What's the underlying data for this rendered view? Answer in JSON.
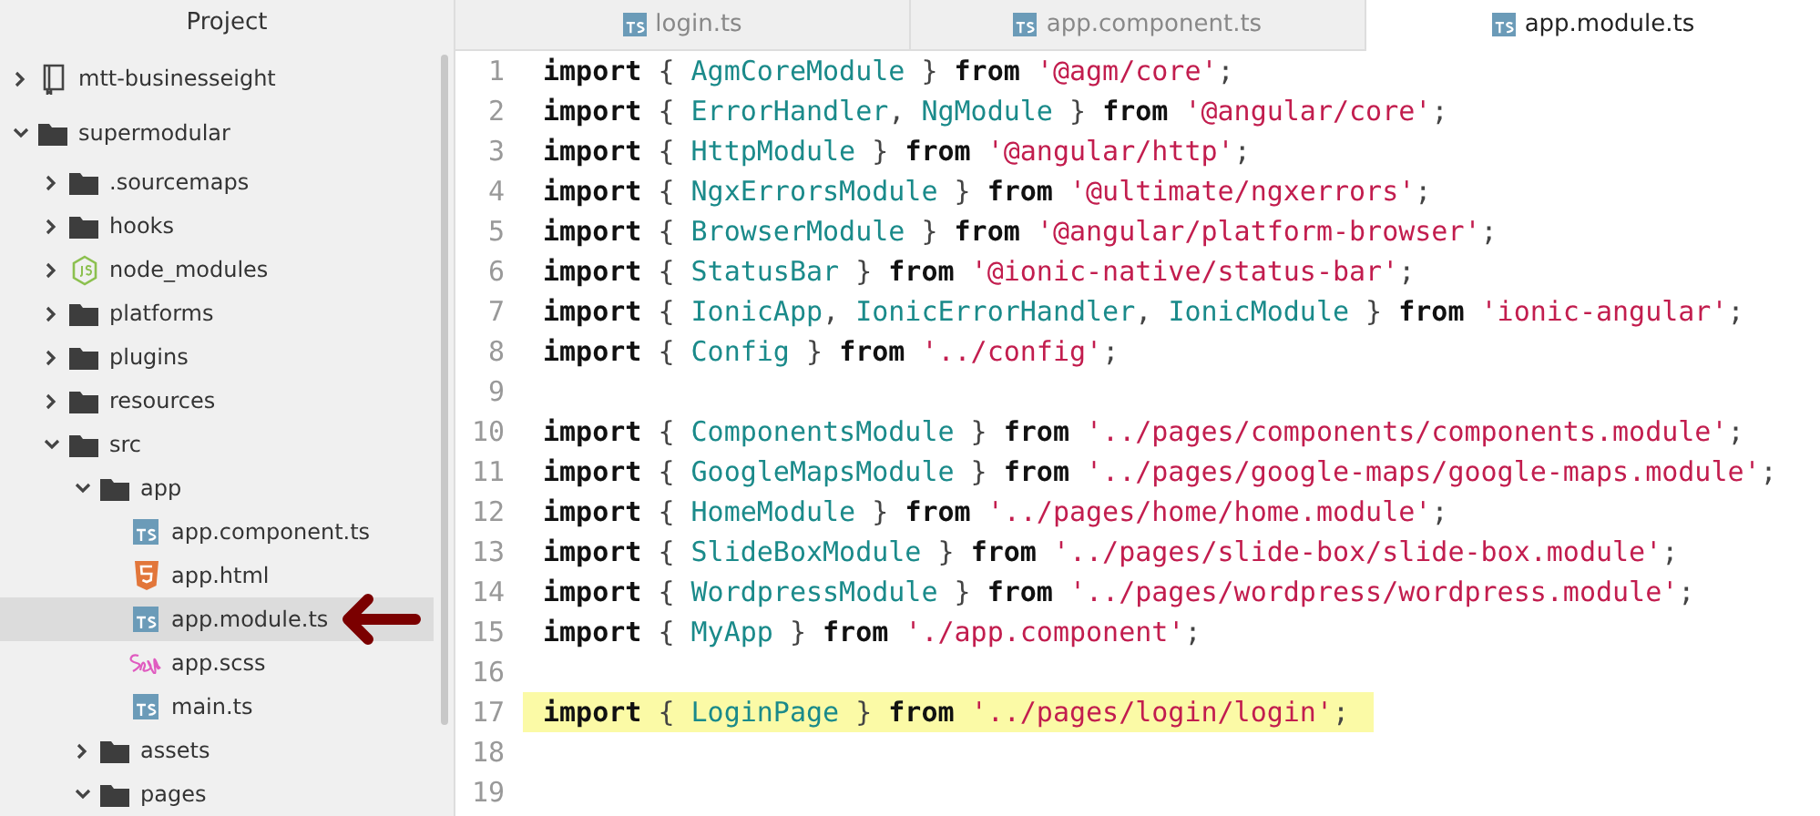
{
  "sidebar": {
    "title": "Project",
    "tree": [
      {
        "label": "mtt-businesseight",
        "kind": "book",
        "expanded": false,
        "selected": false
      },
      {
        "label": "supermodular",
        "kind": "folder",
        "expanded": true,
        "selected": false,
        "children": [
          {
            "label": ".sourcemaps",
            "kind": "folder",
            "expanded": false,
            "selected": false
          },
          {
            "label": "hooks",
            "kind": "folder",
            "expanded": false,
            "selected": false
          },
          {
            "label": "node_modules",
            "kind": "nodejs",
            "expanded": false,
            "selected": false
          },
          {
            "label": "platforms",
            "kind": "folder",
            "expanded": false,
            "selected": false
          },
          {
            "label": "plugins",
            "kind": "folder",
            "expanded": false,
            "selected": false
          },
          {
            "label": "resources",
            "kind": "folder",
            "expanded": false,
            "selected": false
          },
          {
            "label": "src",
            "kind": "folder",
            "expanded": true,
            "selected": false,
            "children": [
              {
                "label": "app",
                "kind": "folder",
                "expanded": true,
                "selected": false,
                "children": [
                  {
                    "label": "app.component.ts",
                    "kind": "ts",
                    "selected": false
                  },
                  {
                    "label": "app.html",
                    "kind": "html",
                    "selected": false
                  },
                  {
                    "label": "app.module.ts",
                    "kind": "ts",
                    "selected": true
                  },
                  {
                    "label": "app.scss",
                    "kind": "sass",
                    "selected": false
                  },
                  {
                    "label": "main.ts",
                    "kind": "ts",
                    "selected": false
                  }
                ]
              },
              {
                "label": "assets",
                "kind": "folder",
                "expanded": false,
                "selected": false
              },
              {
                "label": "pages",
                "kind": "folder",
                "expanded": true,
                "selected": false
              }
            ]
          }
        ]
      }
    ]
  },
  "tabs": [
    {
      "label": "login.ts",
      "selected": false
    },
    {
      "label": "app.component.ts",
      "selected": false
    },
    {
      "label": "app.module.ts",
      "selected": true
    }
  ],
  "editor": {
    "lines": [
      {
        "number": "1",
        "highlighted": false,
        "tokens": [
          {
            "kind": "kw",
            "text": "import "
          },
          {
            "kind": "punct",
            "text": "{ "
          },
          {
            "kind": "ident",
            "text": "AgmCoreModule"
          },
          {
            "kind": "punct",
            "text": " } "
          },
          {
            "kind": "kw",
            "text": "from "
          },
          {
            "kind": "str",
            "text": "'@agm/core'"
          },
          {
            "kind": "punct",
            "text": ";"
          }
        ]
      },
      {
        "number": "2",
        "highlighted": false,
        "tokens": [
          {
            "kind": "kw",
            "text": "import "
          },
          {
            "kind": "punct",
            "text": "{ "
          },
          {
            "kind": "ident",
            "text": "ErrorHandler"
          },
          {
            "kind": "punct",
            "text": ", "
          },
          {
            "kind": "ident",
            "text": "NgModule"
          },
          {
            "kind": "punct",
            "text": " } "
          },
          {
            "kind": "kw",
            "text": "from "
          },
          {
            "kind": "str",
            "text": "'@angular/core'"
          },
          {
            "kind": "punct",
            "text": ";"
          }
        ]
      },
      {
        "number": "3",
        "highlighted": false,
        "tokens": [
          {
            "kind": "kw",
            "text": "import "
          },
          {
            "kind": "punct",
            "text": "{ "
          },
          {
            "kind": "ident",
            "text": "HttpModule"
          },
          {
            "kind": "punct",
            "text": " } "
          },
          {
            "kind": "kw",
            "text": "from "
          },
          {
            "kind": "str",
            "text": "'@angular/http'"
          },
          {
            "kind": "punct",
            "text": ";"
          }
        ]
      },
      {
        "number": "4",
        "highlighted": false,
        "tokens": [
          {
            "kind": "kw",
            "text": "import "
          },
          {
            "kind": "punct",
            "text": "{ "
          },
          {
            "kind": "ident",
            "text": "NgxErrorsModule"
          },
          {
            "kind": "punct",
            "text": " } "
          },
          {
            "kind": "kw",
            "text": "from "
          },
          {
            "kind": "str",
            "text": "'@ultimate/ngxerrors'"
          },
          {
            "kind": "punct",
            "text": ";"
          }
        ]
      },
      {
        "number": "5",
        "highlighted": false,
        "tokens": [
          {
            "kind": "kw",
            "text": "import "
          },
          {
            "kind": "punct",
            "text": "{ "
          },
          {
            "kind": "ident",
            "text": "BrowserModule"
          },
          {
            "kind": "punct",
            "text": " } "
          },
          {
            "kind": "kw",
            "text": "from "
          },
          {
            "kind": "str",
            "text": "'@angular/platform-browser'"
          },
          {
            "kind": "punct",
            "text": ";"
          }
        ]
      },
      {
        "number": "6",
        "highlighted": false,
        "tokens": [
          {
            "kind": "kw",
            "text": "import "
          },
          {
            "kind": "punct",
            "text": "{ "
          },
          {
            "kind": "ident",
            "text": "StatusBar"
          },
          {
            "kind": "punct",
            "text": " } "
          },
          {
            "kind": "kw",
            "text": "from "
          },
          {
            "kind": "str",
            "text": "'@ionic-native/status-bar'"
          },
          {
            "kind": "punct",
            "text": ";"
          }
        ]
      },
      {
        "number": "7",
        "highlighted": false,
        "tokens": [
          {
            "kind": "kw",
            "text": "import "
          },
          {
            "kind": "punct",
            "text": "{ "
          },
          {
            "kind": "ident",
            "text": "IonicApp"
          },
          {
            "kind": "punct",
            "text": ", "
          },
          {
            "kind": "ident",
            "text": "IonicErrorHandler"
          },
          {
            "kind": "punct",
            "text": ", "
          },
          {
            "kind": "ident",
            "text": "IonicModule"
          },
          {
            "kind": "punct",
            "text": " } "
          },
          {
            "kind": "kw",
            "text": "from "
          },
          {
            "kind": "str",
            "text": "'ionic-angular'"
          },
          {
            "kind": "punct",
            "text": ";"
          }
        ]
      },
      {
        "number": "8",
        "highlighted": false,
        "tokens": [
          {
            "kind": "kw",
            "text": "import "
          },
          {
            "kind": "punct",
            "text": "{ "
          },
          {
            "kind": "ident",
            "text": "Config"
          },
          {
            "kind": "punct",
            "text": " } "
          },
          {
            "kind": "kw",
            "text": "from "
          },
          {
            "kind": "str",
            "text": "'../config'"
          },
          {
            "kind": "punct",
            "text": ";"
          }
        ]
      },
      {
        "number": "9",
        "highlighted": false
      },
      {
        "number": "10",
        "highlighted": false,
        "tokens": [
          {
            "kind": "kw",
            "text": "import "
          },
          {
            "kind": "punct",
            "text": "{ "
          },
          {
            "kind": "ident",
            "text": "ComponentsModule"
          },
          {
            "kind": "punct",
            "text": " } "
          },
          {
            "kind": "kw",
            "text": "from "
          },
          {
            "kind": "str",
            "text": "'../pages/components/components.module'"
          },
          {
            "kind": "punct",
            "text": ";"
          }
        ]
      },
      {
        "number": "11",
        "highlighted": false,
        "tokens": [
          {
            "kind": "kw",
            "text": "import "
          },
          {
            "kind": "punct",
            "text": "{ "
          },
          {
            "kind": "ident",
            "text": "GoogleMapsModule"
          },
          {
            "kind": "punct",
            "text": " } "
          },
          {
            "kind": "kw",
            "text": "from "
          },
          {
            "kind": "str",
            "text": "'../pages/google-maps/google-maps.module'"
          },
          {
            "kind": "punct",
            "text": ";"
          }
        ]
      },
      {
        "number": "12",
        "highlighted": false,
        "tokens": [
          {
            "kind": "kw",
            "text": "import "
          },
          {
            "kind": "punct",
            "text": "{ "
          },
          {
            "kind": "ident",
            "text": "HomeModule"
          },
          {
            "kind": "punct",
            "text": " } "
          },
          {
            "kind": "kw",
            "text": "from "
          },
          {
            "kind": "str",
            "text": "'../pages/home/home.module'"
          },
          {
            "kind": "punct",
            "text": ";"
          }
        ]
      },
      {
        "number": "13",
        "highlighted": false,
        "tokens": [
          {
            "kind": "kw",
            "text": "import "
          },
          {
            "kind": "punct",
            "text": "{ "
          },
          {
            "kind": "ident",
            "text": "SlideBoxModule"
          },
          {
            "kind": "punct",
            "text": " } "
          },
          {
            "kind": "kw",
            "text": "from "
          },
          {
            "kind": "str",
            "text": "'../pages/slide-box/slide-box.module'"
          },
          {
            "kind": "punct",
            "text": ";"
          }
        ]
      },
      {
        "number": "14",
        "highlighted": false,
        "tokens": [
          {
            "kind": "kw",
            "text": "import "
          },
          {
            "kind": "punct",
            "text": "{ "
          },
          {
            "kind": "ident",
            "text": "WordpressModule"
          },
          {
            "kind": "punct",
            "text": " } "
          },
          {
            "kind": "kw",
            "text": "from "
          },
          {
            "kind": "str",
            "text": "'../pages/wordpress/wordpress.module'"
          },
          {
            "kind": "punct",
            "text": ";"
          }
        ]
      },
      {
        "number": "15",
        "highlighted": false,
        "tokens": [
          {
            "kind": "kw",
            "text": "import "
          },
          {
            "kind": "punct",
            "text": "{ "
          },
          {
            "kind": "ident",
            "text": "MyApp"
          },
          {
            "kind": "punct",
            "text": " } "
          },
          {
            "kind": "kw",
            "text": "from "
          },
          {
            "kind": "str",
            "text": "'./app.component'"
          },
          {
            "kind": "punct",
            "text": ";"
          }
        ]
      },
      {
        "number": "16",
        "highlighted": false
      },
      {
        "number": "17",
        "highlighted": true,
        "tokens": [
          {
            "kind": "kw",
            "text": "import "
          },
          {
            "kind": "punct",
            "text": "{ "
          },
          {
            "kind": "ident",
            "text": "LoginPage"
          },
          {
            "kind": "punct",
            "text": " } "
          },
          {
            "kind": "kw",
            "text": "from "
          },
          {
            "kind": "str",
            "text": "'../pages/login/login'"
          },
          {
            "kind": "punct",
            "text": ";"
          }
        ]
      },
      {
        "number": "18",
        "highlighted": false
      },
      {
        "number": "19",
        "highlighted": false
      }
    ]
  }
}
